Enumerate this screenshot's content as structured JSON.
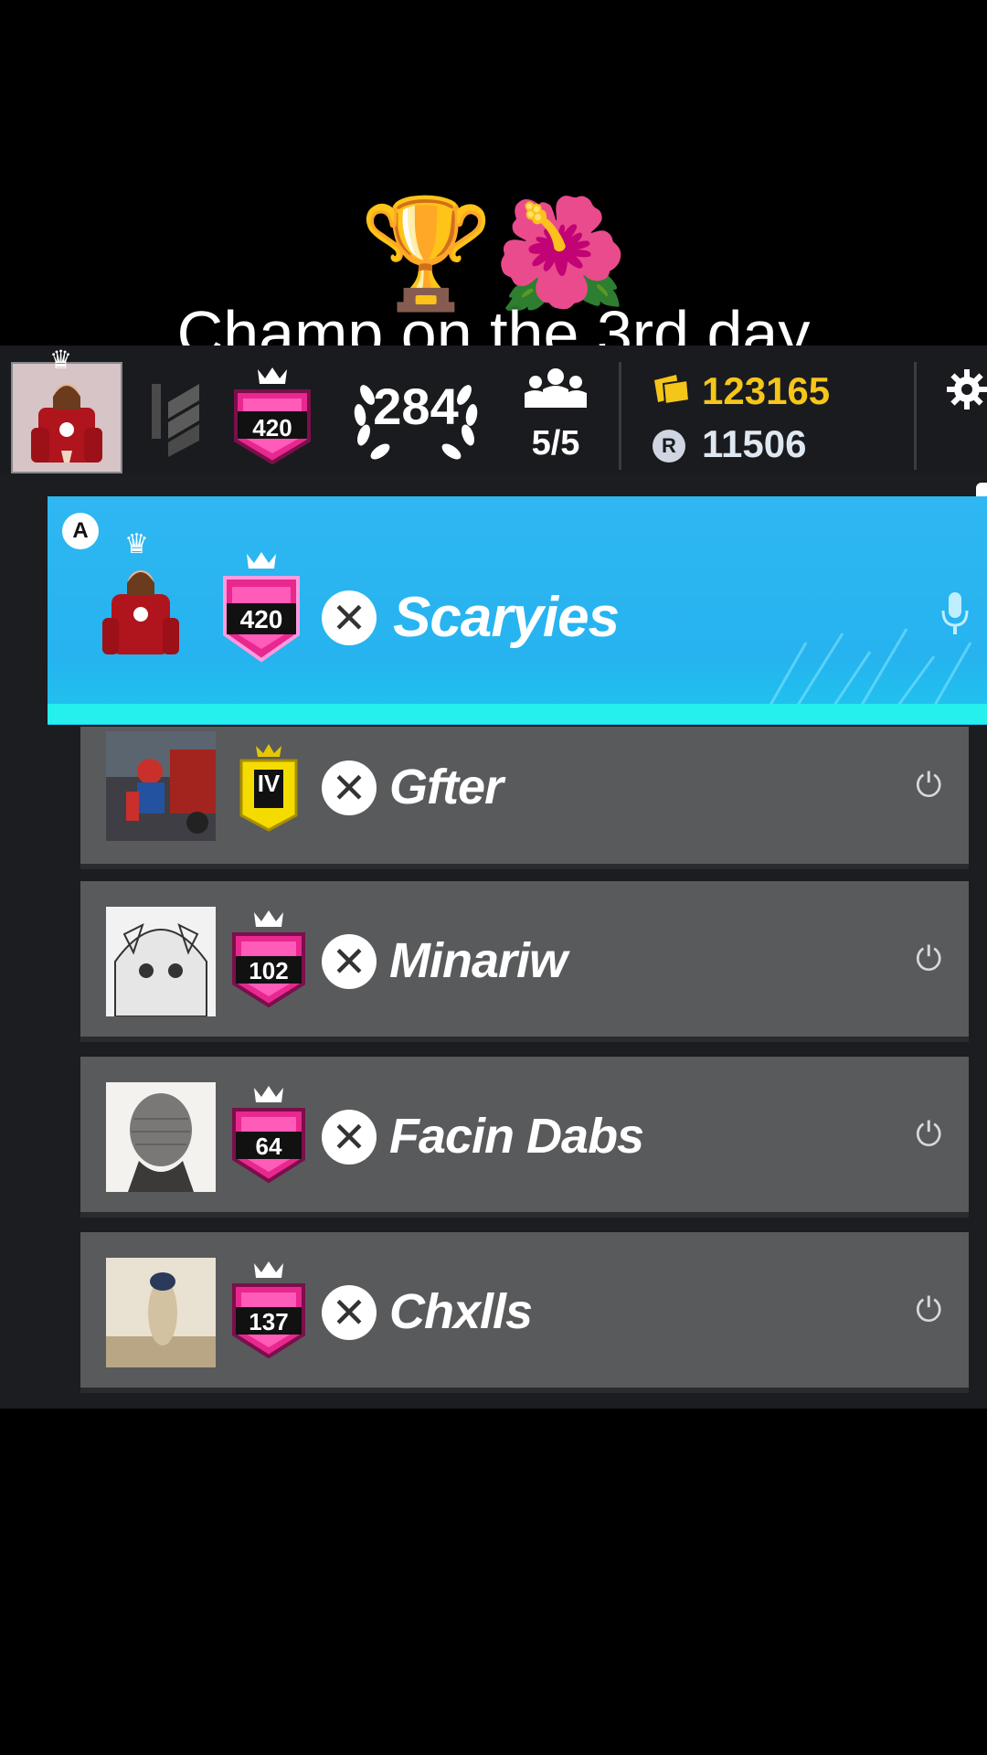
{
  "caption": {
    "emoji": "🏆🌺",
    "text": "Champ on the 3rd day"
  },
  "topbar": {
    "rank_value": "420",
    "level": "284",
    "squad_count": "5/5",
    "currency_gold": "123165",
    "currency_credits": "11506",
    "settings_icon": "gear-icon"
  },
  "squad": [
    {
      "name": "Scaryies",
      "rank": "420",
      "leader_badge": "A",
      "status_icon": "microphone-icon",
      "highlight": true
    },
    {
      "name": "Gfter",
      "rank": "IV",
      "status_icon": "plug-icon"
    },
    {
      "name": "Minariw",
      "rank": "102",
      "status_icon": "plug-icon"
    },
    {
      "name": "Facin Dabs",
      "rank": "64",
      "status_icon": "plug-icon"
    },
    {
      "name": "Chxlls",
      "rank": "137",
      "status_icon": "plug-icon"
    }
  ],
  "colors": {
    "leader_slot": "#2fb7f2",
    "slot_bg": "#595a5c",
    "rank_pink": "#e8278f",
    "gold_currency": "#f5c61a"
  }
}
